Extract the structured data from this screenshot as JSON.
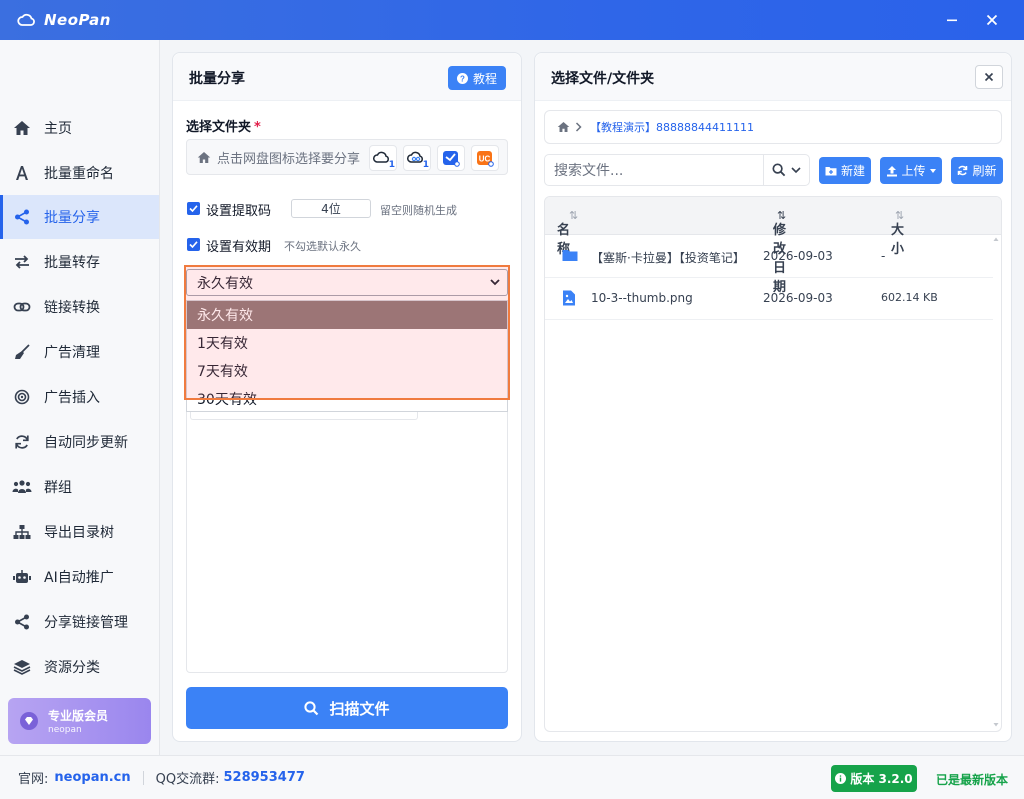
{
  "app": {
    "name": "NeoPan"
  },
  "sidebar": {
    "items": [
      {
        "label": "主页",
        "icon": "home-icon"
      },
      {
        "label": "批量重命名",
        "icon": "font-icon"
      },
      {
        "label": "批量分享",
        "icon": "share-icon",
        "active": true
      },
      {
        "label": "批量转存",
        "icon": "transfer-icon"
      },
      {
        "label": "链接转换",
        "icon": "link-icon"
      },
      {
        "label": "广告清理",
        "icon": "broom-icon"
      },
      {
        "label": "广告插入",
        "icon": "target-icon"
      },
      {
        "label": "自动同步更新",
        "icon": "sync-icon"
      },
      {
        "label": "群组",
        "icon": "users-icon"
      },
      {
        "label": "导出目录树",
        "icon": "tree-icon"
      },
      {
        "label": "AI自动推广",
        "icon": "robot-icon"
      },
      {
        "label": "分享链接管理",
        "icon": "share-nodes-icon"
      },
      {
        "label": "资源分类",
        "icon": "layers-icon"
      }
    ],
    "vip": {
      "title": "专业版会员",
      "subtitle": "neopan"
    }
  },
  "left_panel": {
    "title": "批量分享",
    "tutorial_label": "教程",
    "folder_label": "选择文件夹",
    "required_mark": "*",
    "folder_placeholder": "点击网盘图标选择要分享",
    "cloud_badges": [
      "1",
      "1"
    ],
    "code_checkbox_label": "设置提取码",
    "code_value": "4位",
    "code_hint": "留空则随机生成",
    "expiry_checkbox_label": "设置有效期",
    "expiry_hint": "不勾选默认永久",
    "expiry_selected": "永久有效",
    "expiry_options": [
      "永久有效",
      "1天有效",
      "7天有效",
      "30天有效"
    ],
    "scan_label": "扫描文件"
  },
  "right_panel": {
    "title": "选择文件/文件夹",
    "breadcrumb": "【教程演示】88888844411111",
    "search_placeholder": "搜索文件...",
    "new_label": "新建",
    "upload_label": "上传",
    "refresh_label": "刷新",
    "columns": {
      "name": "名称",
      "date": "修改日期",
      "size": "大小"
    },
    "rows": [
      {
        "name": "【塞斯·卡拉曼】【投资笔记】",
        "date": "2026-09-03",
        "size": "-",
        "type": "folder"
      },
      {
        "name": "10-3--thumb.png",
        "date": "2026-09-03",
        "size": "602.14 KB",
        "type": "image"
      }
    ]
  },
  "statusbar": {
    "site_label": "官网:",
    "site_value": "neopan.cn",
    "qq_label": "QQ交流群:",
    "qq_value": "528953477",
    "version": "版本 3.2.0",
    "latest": "已是最新版本"
  },
  "colors": {
    "primary": "#3b82f6",
    "titlebar": "#2f66e8",
    "success": "#16a34a",
    "highlight": "#f07b3f"
  }
}
